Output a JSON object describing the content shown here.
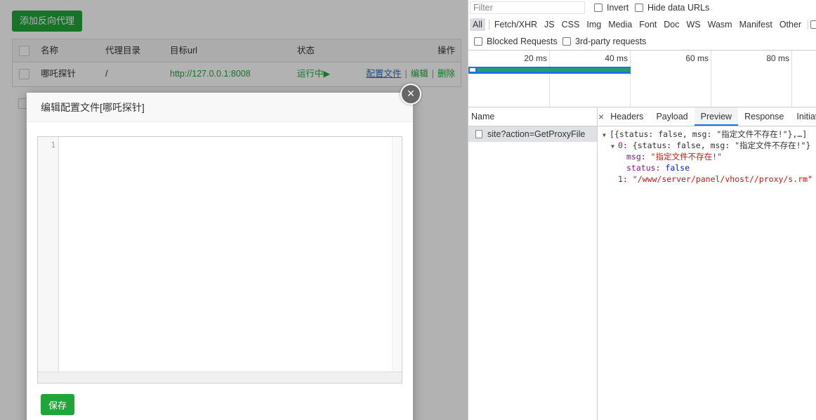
{
  "panel": {
    "add_button": "添加反向代理",
    "table": {
      "headers": [
        "名称",
        "代理目录",
        "目标url",
        "状态",
        "操作"
      ],
      "row": {
        "name": "哪吒探针",
        "dir": "/",
        "url": "http://127.0.0.1:8008",
        "status": "运行中",
        "status_icon": "play-triangle-icon",
        "ops": [
          "配置文件",
          "编辑",
          "删除"
        ],
        "op_separator": "|"
      }
    },
    "dialog": {
      "title": "编辑配置文件[哪吒探针]",
      "close_glyph": "×",
      "line_number": "1",
      "save_button": "保存"
    }
  },
  "devtools": {
    "filter_placeholder": "Filter",
    "invert_label": "Invert",
    "hide_data_urls_label": "Hide data URLs",
    "types": [
      "All",
      "Fetch/XHR",
      "JS",
      "CSS",
      "Img",
      "Media",
      "Font",
      "Doc",
      "WS",
      "Wasm",
      "Manifest",
      "Other"
    ],
    "active_type": "All",
    "blocked_requests_label": "Blocked Requests",
    "third_party_label": "3rd-party requests",
    "timeline_ticks": [
      "20 ms",
      "40 ms",
      "60 ms",
      "80 ms"
    ],
    "name_header": "Name",
    "request_name": "site?action=GetProxyFile",
    "close_glyph": "×",
    "tabs": [
      "Headers",
      "Payload",
      "Preview",
      "Response",
      "Initiator"
    ],
    "active_tab": "Preview",
    "preview": {
      "line0": "[{status: false, msg: \"指定文件不存在!\"},…]",
      "line1_key": "0:",
      "line1_val": "{status: false, msg: \"指定文件不存在!\"}",
      "msg_key": "msg:",
      "msg_val": "\"指定文件不存在!\"",
      "status_key": "status:",
      "status_val": "false",
      "line4_key": "1:",
      "line4_val": "\"/www/server/panel/vhost//proxy/s.rm\""
    }
  },
  "colors": {
    "accent_green": "#20a53a",
    "devtools_blue": "#1a73e8"
  }
}
